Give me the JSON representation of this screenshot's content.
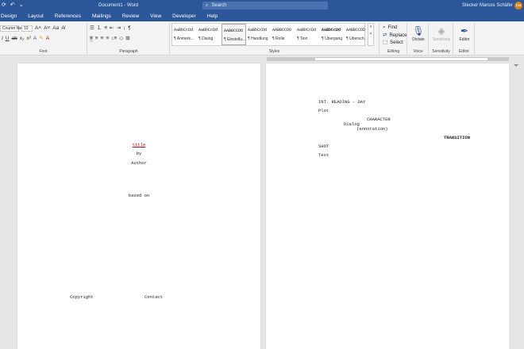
{
  "titlebar": {
    "title": "Document1 - Word",
    "search_placeholder": "Search",
    "user": "Stecker Marcos Schäfer",
    "avatar": "SM"
  },
  "menu": {
    "tabs": [
      "Design",
      "Layout",
      "References",
      "Mailings",
      "Review",
      "View",
      "Developer",
      "Help"
    ]
  },
  "ribbon": {
    "font": {
      "family": "Courier New",
      "size": "10",
      "label": "Font"
    },
    "paragraph": {
      "label": "Paragraph"
    },
    "styles": {
      "label": "Styles",
      "items": [
        {
          "sample": "AaBbCcDd",
          "name": "¶ Anmerk..."
        },
        {
          "sample": "AaBbCcDd",
          "name": "¶ Dialog"
        },
        {
          "sample": "AABBCCDD",
          "name": "¶ Einstellu..."
        },
        {
          "sample": "AaBbCcDd",
          "name": "¶ Handlung"
        },
        {
          "sample": "AABBCCDD",
          "name": "¶ Rolle"
        },
        {
          "sample": "AaBbCcDd",
          "name": "¶ Text"
        },
        {
          "sample": "AaBbCcDd",
          "name": "¶ Übergang"
        },
        {
          "sample": "AABBCCDD",
          "name": "¶ Übersch..."
        }
      ]
    },
    "editing": {
      "label": "Editing",
      "find": "Find",
      "replace": "Replace",
      "select": "Select"
    },
    "voice": {
      "label": "Voice",
      "dictate": "Dictate"
    },
    "sensitivity": {
      "label": "Sensitivity",
      "button": "Sensitivity"
    },
    "editor": {
      "label": "Editor",
      "button": "Editor"
    }
  },
  "page1": {
    "title": "title",
    "by": "by",
    "author": "Author",
    "based_on": "based on",
    "copyright": "Copyright",
    "contact": "Contact"
  },
  "page2": {
    "scene_heading": "INT. READING - DAY",
    "plot": "Plot",
    "character": "CHARACTER",
    "dialog": "Dialog",
    "annotation": "(annotation)",
    "transition": "TRANSITION",
    "shot": "SHOT",
    "text": "Text"
  }
}
